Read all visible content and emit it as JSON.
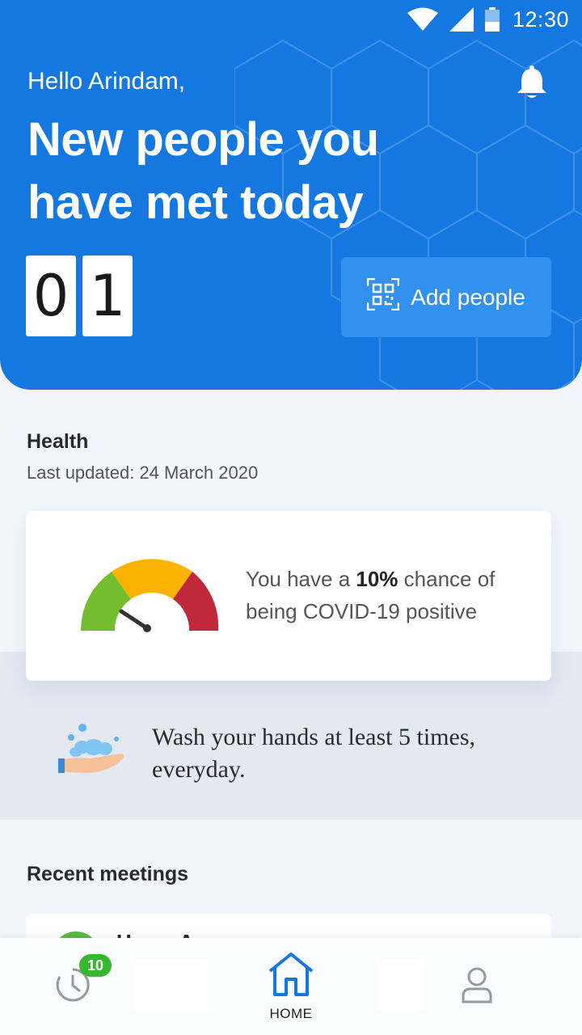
{
  "status_bar": {
    "time": "12:30",
    "icons": [
      "wifi-icon",
      "signal-icon",
      "battery-icon"
    ]
  },
  "header": {
    "greeting": "Hello Arindam,",
    "headline": "New people you have met today",
    "count_digits": [
      "0",
      "1"
    ],
    "add_people_label": "Add people",
    "bell_icon": "bell-icon",
    "qr_icon": "qr-code-icon"
  },
  "health": {
    "title": "Health",
    "last_updated": "Last updated: 24 March 2020",
    "risk_prefix": "You have a ",
    "risk_value": "10%",
    "risk_suffix": " chance of being COVID-19 positive",
    "gauge_level": 0.1
  },
  "tip": {
    "text": "Wash your hands at least 5 times, everyday.",
    "icon": "hand-wash-icon"
  },
  "recent": {
    "title": "Recent meetings",
    "first_name_partial": "Hema A"
  },
  "bottom_nav": {
    "history_badge": "10",
    "home_label": "HOME",
    "icons": [
      "clock-icon",
      "home-icon",
      "user-icon"
    ]
  },
  "colors": {
    "primary": "#1478e0",
    "button": "#3290ee",
    "gauge_green": "#74bd2f",
    "gauge_yellow": "#fbb200",
    "gauge_red": "#c1283b",
    "badge_green": "#35b82d"
  }
}
